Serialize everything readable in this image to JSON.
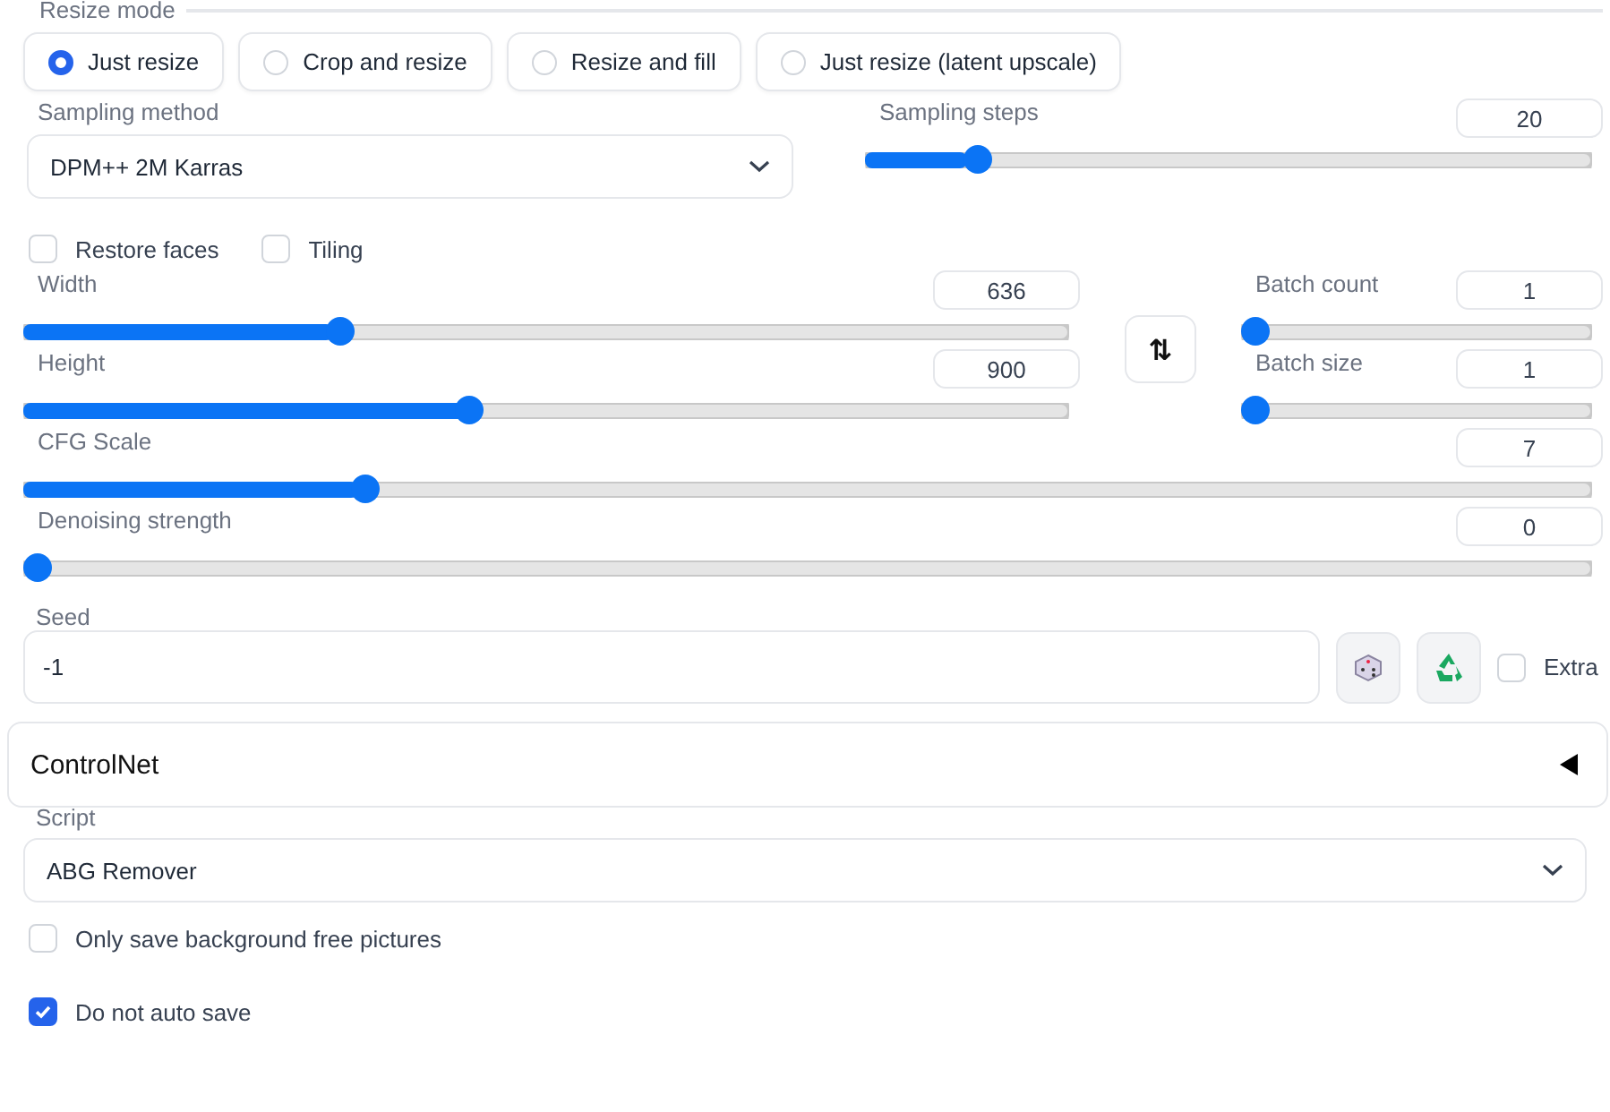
{
  "resize_mode": {
    "label": "Resize mode",
    "options": [
      {
        "label": "Just resize",
        "selected": true
      },
      {
        "label": "Crop and resize",
        "selected": false
      },
      {
        "label": "Resize and fill",
        "selected": false
      },
      {
        "label": "Just resize (latent upscale)",
        "selected": false
      }
    ]
  },
  "sampling_method": {
    "label": "Sampling method",
    "value": "DPM++ 2M Karras"
  },
  "sampling_steps": {
    "label": "Sampling steps",
    "value": "20",
    "level": 0.14
  },
  "options": [
    {
      "label": "Restore faces",
      "checked": false
    },
    {
      "label": "Tiling",
      "checked": false
    }
  ],
  "width": {
    "label": "Width",
    "value": "636",
    "level": 0.297
  },
  "height": {
    "label": "Height",
    "value": "900",
    "level": 0.425
  },
  "batch_count": {
    "label": "Batch count",
    "value": "1",
    "level": 0
  },
  "batch_size": {
    "label": "Batch size",
    "value": "1",
    "level": 0
  },
  "swap_button": {
    "label": "⇅"
  },
  "cfg_scale": {
    "label": "CFG Scale",
    "value": "7",
    "level": 0.213
  },
  "denoising_strength": {
    "label": "Denoising strength",
    "value": "0",
    "level": 0
  },
  "seed": {
    "label": "Seed",
    "value": "-1",
    "extra": {
      "label": "Extra",
      "checked": false
    }
  },
  "controlnet": {
    "title": "ControlNet",
    "expanded": false
  },
  "script": {
    "label": "Script",
    "value": "ABG Remover"
  },
  "script_options": [
    {
      "label": "Only save background free pictures",
      "checked": false
    },
    {
      "label": "Do not auto save",
      "checked": true
    }
  ]
}
